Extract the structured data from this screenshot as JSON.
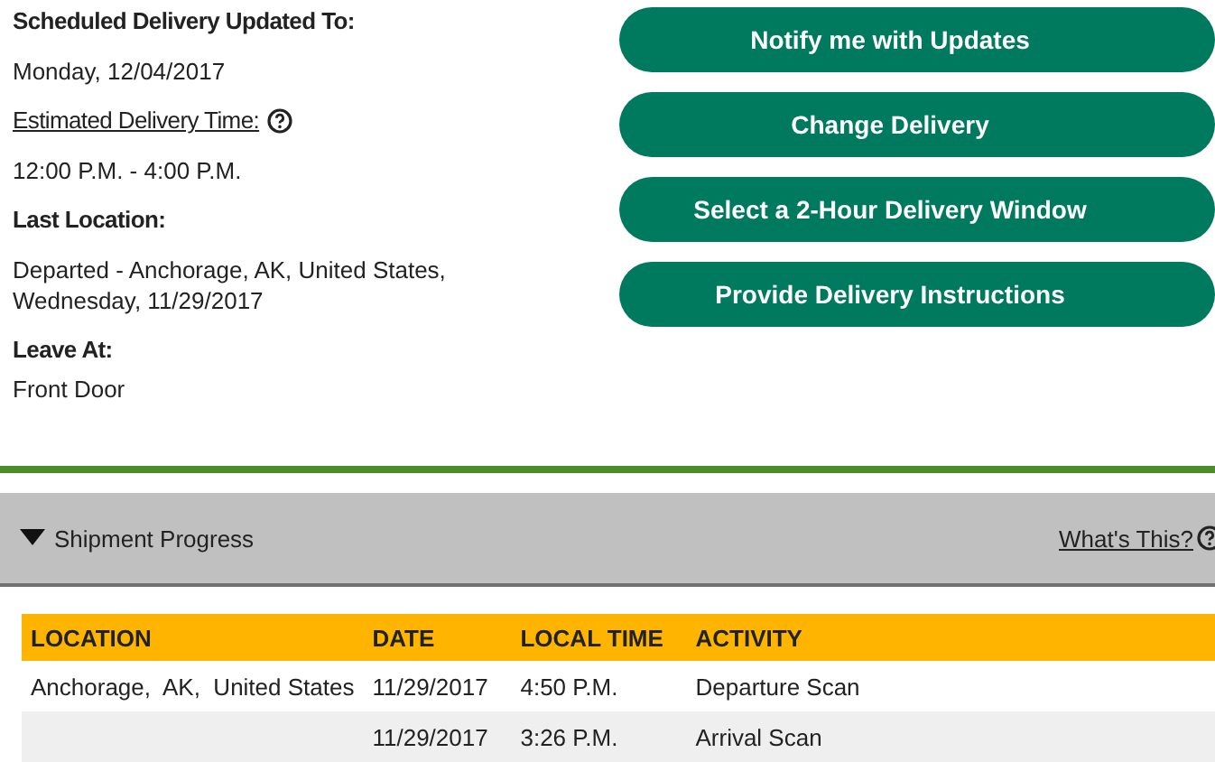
{
  "details": [
    {
      "label": "Scheduled Delivery Updated To:",
      "underlined": false,
      "help": false,
      "value": "Monday, 12/04/2017"
    },
    {
      "label": "Estimated Delivery Time:",
      "underlined": true,
      "help": true,
      "value": "12:00 P.M. - 4:00 P.M."
    },
    {
      "label": "Last Location:",
      "underlined": false,
      "help": false,
      "value": "Departed - Anchorage, AK, United States, Wednesday, 11/29/2017"
    },
    {
      "label": "Leave At:",
      "underlined": false,
      "help": false,
      "value": "Front Door"
    }
  ],
  "buttons": [
    "Notify me with Updates",
    "Change Delivery",
    "Select a 2-Hour Delivery Window",
    "Provide Delivery Instructions"
  ],
  "progress": {
    "title": "Shipment Progress",
    "expanded": true,
    "help_link": "What's This?"
  },
  "table": {
    "columns": [
      "LOCATION",
      "DATE",
      "LOCAL TIME",
      "ACTIVITY"
    ],
    "rows": [
      [
        "Anchorage,  AK,  United States",
        "11/29/2017",
        "4:50 P.M.",
        "Departure Scan"
      ],
      [
        "",
        "11/29/2017",
        "3:26 P.M.",
        "Arrival Scan"
      ]
    ]
  }
}
